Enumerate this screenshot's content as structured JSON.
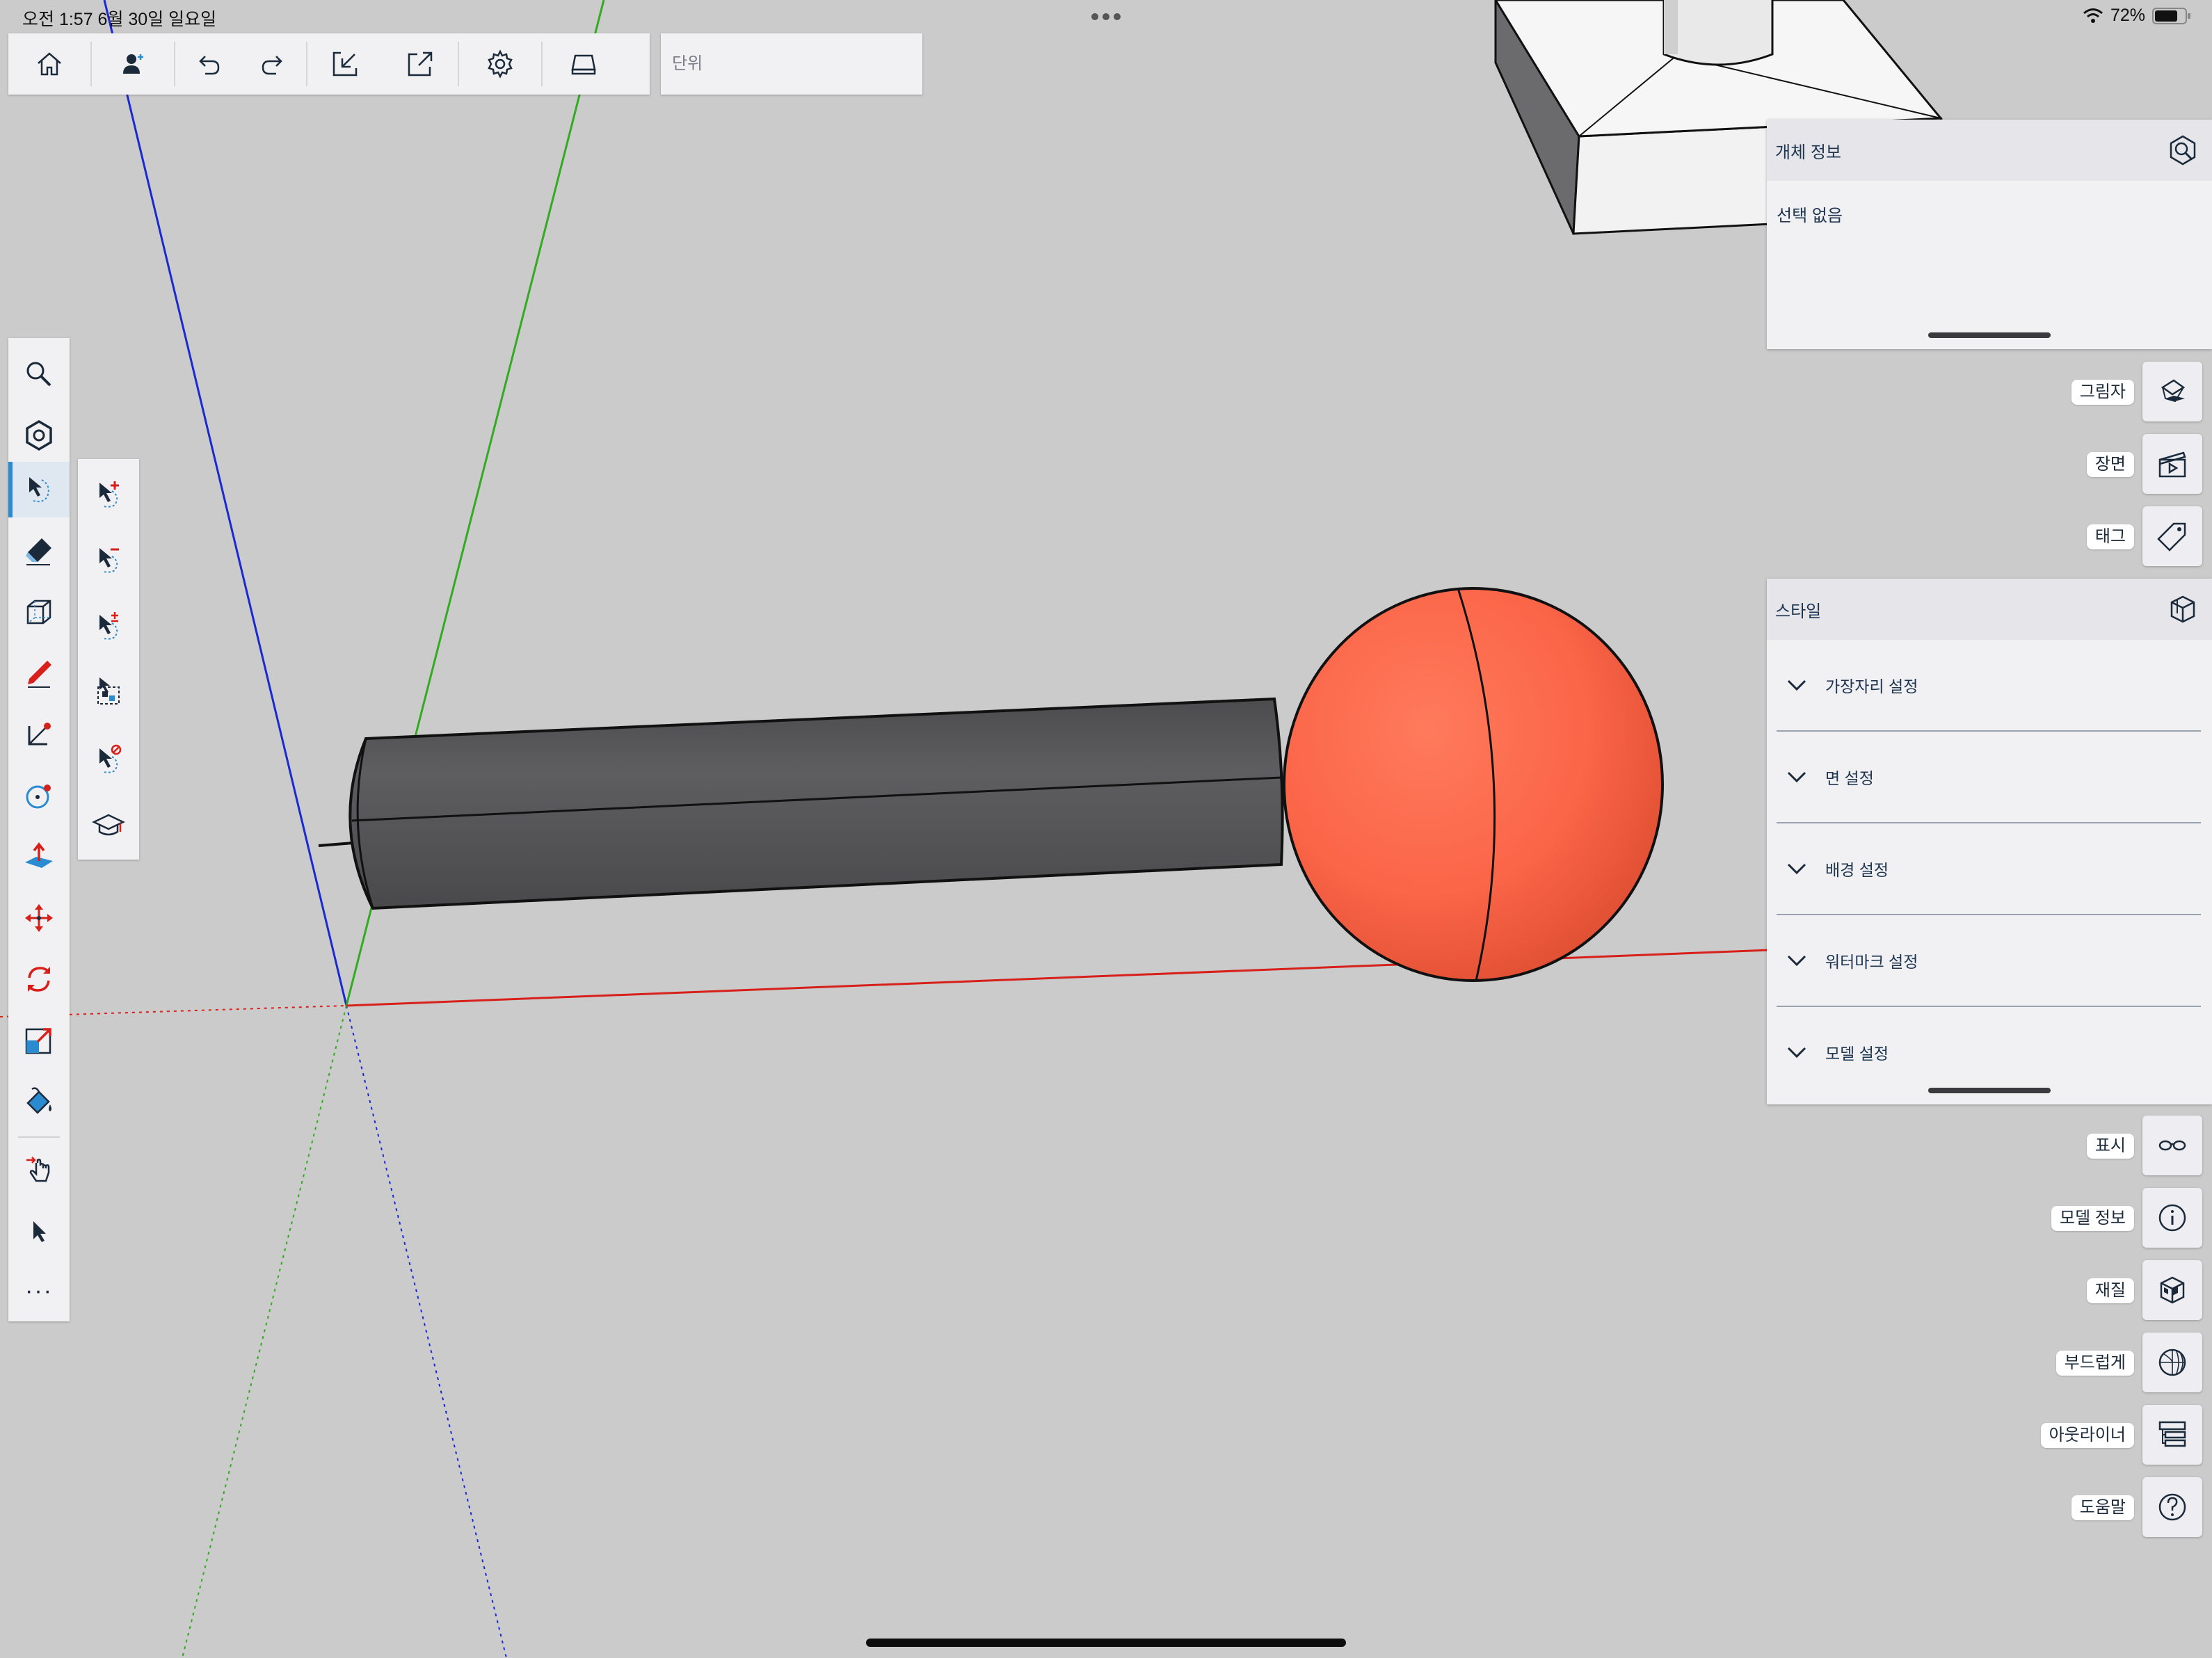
{
  "status": {
    "time_date": "오전 1:57   6월 30일 일요일",
    "battery": "72%"
  },
  "top_toolbar": {
    "buttons": [
      {
        "name": "home-button",
        "icon": "home-icon"
      },
      {
        "name": "add-user-button",
        "icon": "person-add-icon"
      },
      {
        "name": "undo-button",
        "icon": "undo-icon"
      },
      {
        "name": "redo-button",
        "icon": "redo-icon"
      },
      {
        "name": "import-button",
        "icon": "import-icon"
      },
      {
        "name": "export-button",
        "icon": "export-icon"
      },
      {
        "name": "settings-button",
        "icon": "gear-icon"
      },
      {
        "name": "display-button",
        "icon": "drive-icon"
      }
    ],
    "unit_placeholder": "단위"
  },
  "entity_info": {
    "title": "개체 정보",
    "status": "선택 없음"
  },
  "style_panel": {
    "title": "스타일",
    "rows": [
      "가장자리 설정",
      "면 설정",
      "배경 설정",
      "워터마크 설정",
      "모델 설정"
    ]
  },
  "side_buttons": [
    {
      "label": "그림자",
      "icon": "shadow-icon"
    },
    {
      "label": "장면",
      "icon": "scene-icon"
    },
    {
      "label": "태그",
      "icon": "tag-icon"
    },
    {
      "label": "표시",
      "icon": "glasses-icon"
    },
    {
      "label": "모델 정보",
      "icon": "info-icon"
    },
    {
      "label": "재질",
      "icon": "material-icon"
    },
    {
      "label": "부드럽게",
      "icon": "soften-icon"
    },
    {
      "label": "아웃라이너",
      "icon": "outliner-icon"
    },
    {
      "label": "도움말",
      "icon": "help-icon"
    }
  ],
  "left_toolbar": {
    "tools": [
      "search",
      "orbit",
      "select",
      "eraser",
      "box",
      "pencil",
      "rectangle",
      "circle",
      "push-pull",
      "move",
      "rotate",
      "scale",
      "paint-bucket",
      "gesture",
      "pointer",
      "more"
    ],
    "active": "select",
    "more_label": "···"
  },
  "colors": {
    "canvas": "#cbcbcb",
    "accent": "#2a8bd0",
    "sphere": "#ff6a4d",
    "cylinder": "#58585a",
    "axis_red": "#d8201a",
    "axis_green": "#33aa22",
    "axis_blue": "#1a2ad0"
  }
}
